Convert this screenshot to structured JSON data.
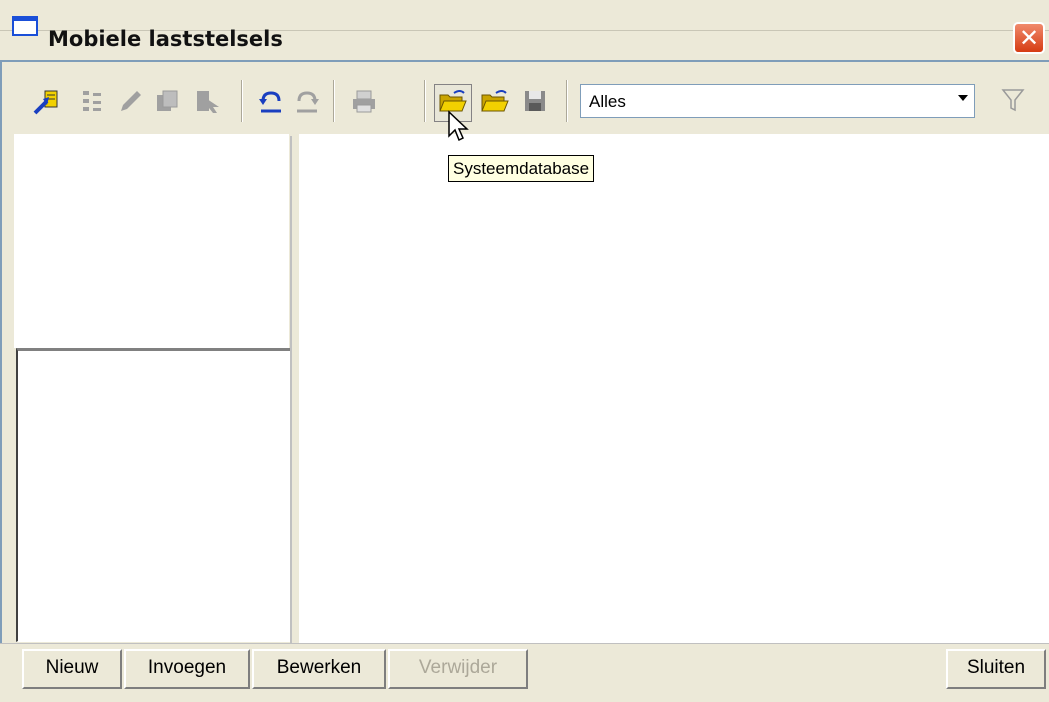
{
  "window": {
    "title": "Mobiele laststelsels",
    "close_glyph": "✕"
  },
  "toolbar": {
    "buttons": [
      {
        "name": "wizard-icon"
      },
      {
        "name": "properties-icon"
      },
      {
        "name": "edit-icon"
      },
      {
        "name": "copy-icon"
      },
      {
        "name": "select-icon"
      },
      {
        "name": "undo-icon"
      },
      {
        "name": "redo-icon"
      },
      {
        "name": "print-icon"
      },
      {
        "name": "open-system-database-icon"
      },
      {
        "name": "open-folder-icon"
      },
      {
        "name": "save-icon"
      }
    ],
    "filter_select": {
      "value": "Alles"
    },
    "filter_icon": "funnel-icon"
  },
  "tooltip": {
    "text": "Systeemdatabase"
  },
  "buttons": {
    "new": "Nieuw",
    "insert": "Invoegen",
    "edit": "Bewerken",
    "delete": "Verwijder",
    "close": "Sluiten"
  },
  "colors": {
    "window_bg": "#ece9d8",
    "close_button": "#d63c13",
    "tooltip_bg": "#ffffe1",
    "accent_blue": "#1a4fd8"
  }
}
